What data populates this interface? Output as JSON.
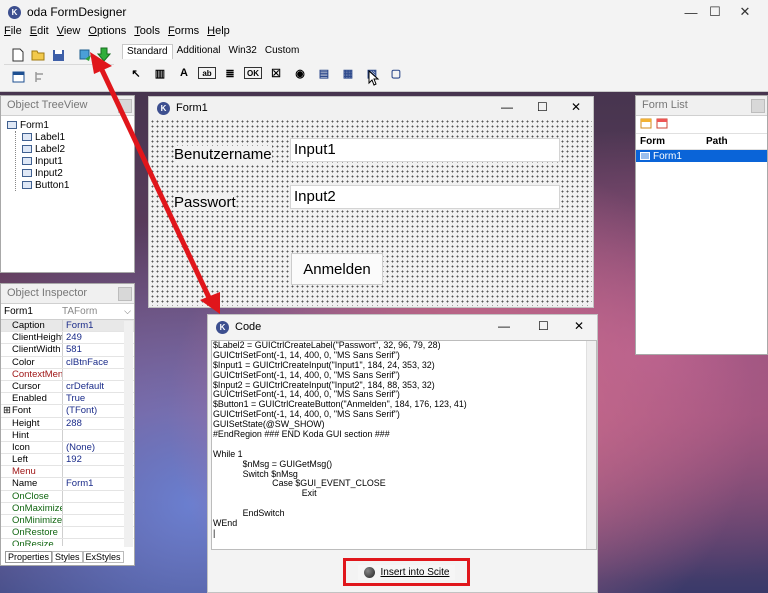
{
  "app": {
    "title": "oda FormDesigner",
    "logo_letter": "K",
    "window_controls": [
      "—",
      "☐",
      "✕"
    ]
  },
  "menu": [
    "File",
    "Edit",
    "View",
    "Options",
    "Tools",
    "Forms",
    "Help"
  ],
  "palette_tabs": [
    "Standard",
    "Additional",
    "Win32",
    "Custom"
  ],
  "palette_icons": [
    "pointer-icon",
    "group-icon",
    "label-icon",
    "input-icon",
    "edit-icon",
    "button-icon",
    "checkbox-icon",
    "radio-icon",
    "combo-icon",
    "list-icon",
    "date-icon",
    "listview-icon"
  ],
  "palette_glyphs": [
    "↖",
    "▥",
    "A",
    "ab",
    "≣",
    "OK",
    "☒",
    "◉",
    "▤",
    "▦",
    "▧",
    "▢"
  ],
  "treeview": {
    "title": "Object TreeView",
    "root": "Form1",
    "children": [
      "Label1",
      "Label2",
      "Input1",
      "Input2",
      "Button1"
    ]
  },
  "inspector": {
    "title": "Object Inspector",
    "object_name": "Form1",
    "object_class": "TAForm",
    "rows": [
      {
        "name": "Caption",
        "value": "Form1"
      },
      {
        "name": "ClientHeight",
        "value": "249"
      },
      {
        "name": "ClientWidth",
        "value": "581"
      },
      {
        "name": "Color",
        "value": "clBtnFace"
      },
      {
        "name": "ContextMenu",
        "value": ""
      },
      {
        "name": "Cursor",
        "value": "crDefault"
      },
      {
        "name": "Enabled",
        "value": "True"
      },
      {
        "name": "Font",
        "value": "(TFont)"
      },
      {
        "name": "Height",
        "value": "288"
      },
      {
        "name": "Hint",
        "value": ""
      },
      {
        "name": "Icon",
        "value": "(None)"
      },
      {
        "name": "Left",
        "value": "192"
      },
      {
        "name": "Menu",
        "value": ""
      },
      {
        "name": "Name",
        "value": "Form1"
      },
      {
        "name": "OnClose",
        "value": ""
      },
      {
        "name": "OnMaximize",
        "value": ""
      },
      {
        "name": "OnMinimize",
        "value": ""
      },
      {
        "name": "OnRestore",
        "value": ""
      },
      {
        "name": "OnResize",
        "value": ""
      }
    ],
    "tabs": [
      "Properties",
      "Styles",
      "ExStyles"
    ]
  },
  "form1": {
    "title": "Form1",
    "label1": "Benutzername",
    "label2": "Passwort",
    "input1": "Input1",
    "input2": "Input2",
    "button": "Anmelden"
  },
  "code": {
    "title": "Code",
    "lines": [
      "$Label2 = GUICtrlCreateLabel(\"Passwort\", 32, 96, 79, 28)",
      "GUICtrlSetFont(-1, 14, 400, 0, \"MS Sans Serif\")",
      "$Input1 = GUICtrlCreateInput(\"Input1\", 184, 24, 353, 32)",
      "GUICtrlSetFont(-1, 14, 400, 0, \"MS Sans Serif\")",
      "$Input2 = GUICtrlCreateInput(\"Input2\", 184, 88, 353, 32)",
      "GUICtrlSetFont(-1, 14, 400, 0, \"MS Sans Serif\")",
      "$Button1 = GUICtrlCreateButton(\"Anmelden\", 184, 176, 123, 41)",
      "GUICtrlSetFont(-1, 14, 400, 0, \"MS Sans Serif\")",
      "GUISetState(@SW_SHOW)",
      "#EndRegion ### END Koda GUI section ###",
      "",
      "While 1",
      "            $nMsg = GUIGetMsg()",
      "            Switch $nMsg",
      "                        Case $GUI_EVENT_CLOSE",
      "                                    Exit",
      "",
      "            EndSwitch",
      "WEnd",
      "|"
    ],
    "insert_button": "Insert into Scite"
  },
  "formlist": {
    "title": "Form List",
    "columns": [
      "Form",
      "Path"
    ],
    "rows": [
      {
        "form": "Form1",
        "path": ""
      }
    ]
  },
  "colors": {
    "selection": "#0a64d8",
    "annotation_red": "#e0161b",
    "treeview_icon": "#406090"
  }
}
